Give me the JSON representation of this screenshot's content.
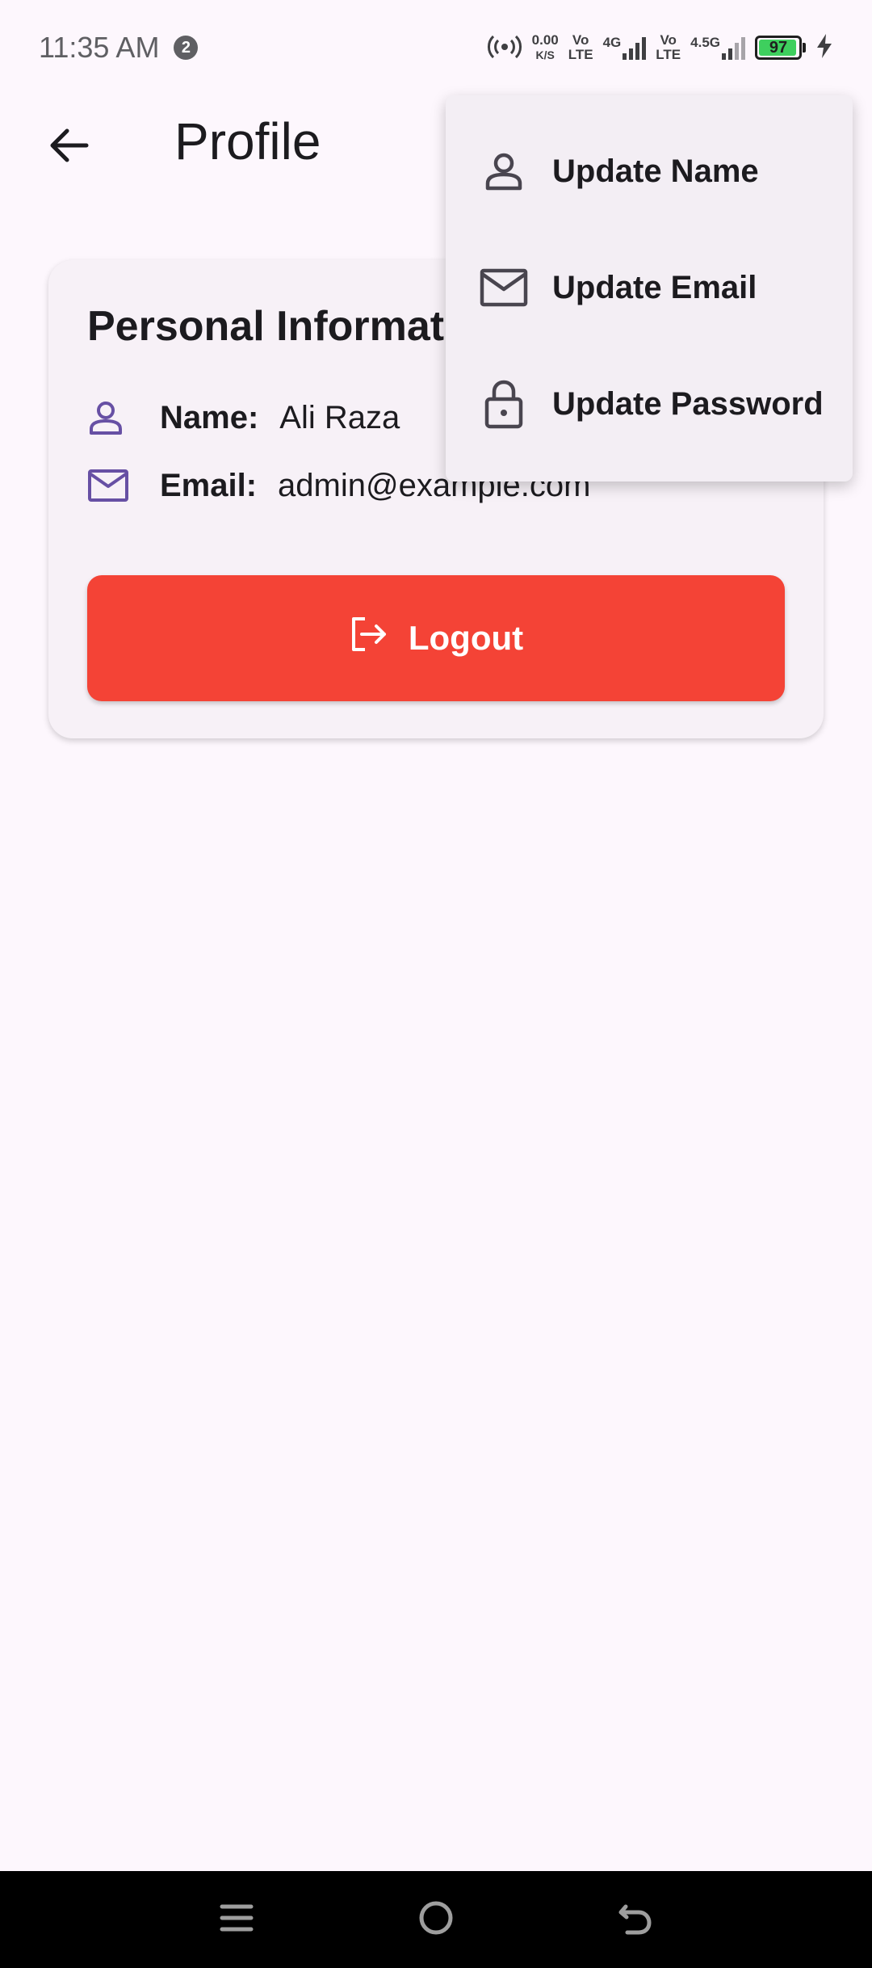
{
  "status_bar": {
    "time": "11:35 AM",
    "notification_count": "2",
    "net_speed_value": "0.00",
    "net_speed_unit": "K/S",
    "sim1_vo": "Vo",
    "sim1_lte": "LTE",
    "sim1_network": "4G",
    "sim2_vo": "Vo",
    "sim2_lte": "LTE",
    "sim2_network": "4.5G",
    "battery_level": "97",
    "battery_fraction": 0.97,
    "battery_color": "#3ecf5e"
  },
  "app_bar": {
    "title": "Profile",
    "back_icon": "arrow-left-icon"
  },
  "card": {
    "title": "Personal Information",
    "name_label": "Name:",
    "name_value": "Ali Raza",
    "email_label": "Email:",
    "email_value": "admin@example.com",
    "logout_label": "Logout",
    "logout_color": "#f44336"
  },
  "menu": {
    "items": [
      {
        "label": "Update Name",
        "icon": "person-icon"
      },
      {
        "label": "Update Email",
        "icon": "mail-icon"
      },
      {
        "label": "Update Password",
        "icon": "lock-icon"
      }
    ]
  },
  "nav_bar": {
    "buttons": [
      "menu-icon",
      "home-icon",
      "back-icon"
    ]
  },
  "colors": {
    "accent": "#6750a4",
    "background": "#fdf7fd"
  }
}
